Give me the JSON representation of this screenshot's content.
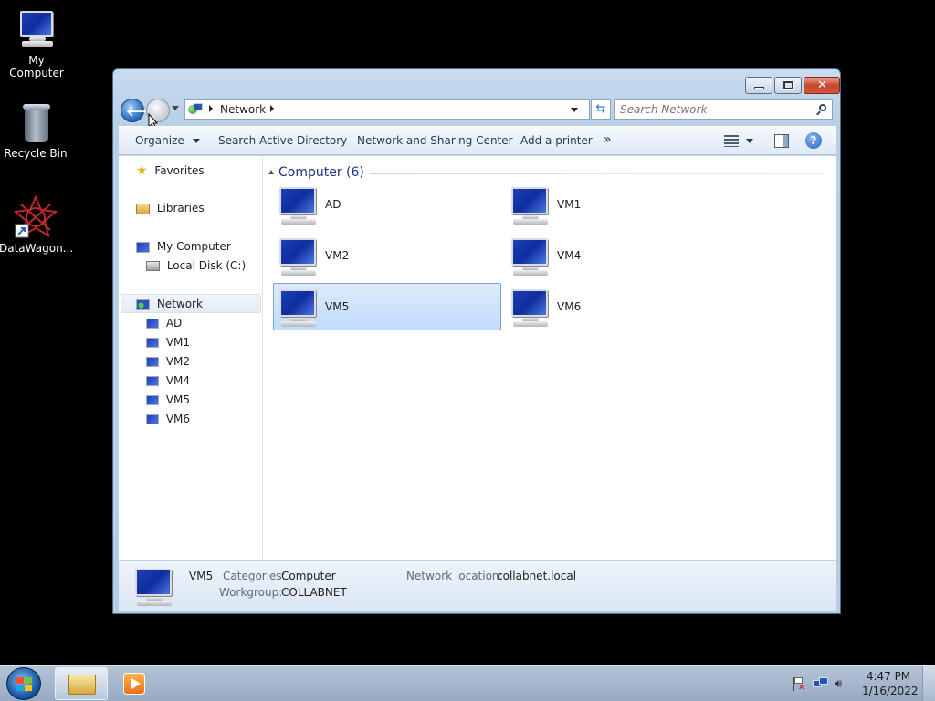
{
  "desktop": {
    "icons": [
      {
        "label": "My Computer"
      },
      {
        "label": "Recycle Bin"
      },
      {
        "label": "DataWagon..."
      }
    ]
  },
  "window": {
    "address": {
      "segment": "Network"
    },
    "search": {
      "placeholder": "Search Network"
    },
    "toolbar": {
      "organize": "Organize",
      "search_ad": "Search Active Directory",
      "network_sharing": "Network and Sharing Center",
      "add_printer": "Add a printer",
      "more": "»"
    },
    "nav_pane": {
      "favorites": "Favorites",
      "libraries": "Libraries",
      "my_computer": "My Computer",
      "local_disk": "Local Disk (C:)",
      "network": "Network",
      "network_children": [
        "AD",
        "VM1",
        "VM2",
        "VM4",
        "VM5",
        "VM6"
      ]
    },
    "group": {
      "header": "Computer (6)"
    },
    "items": [
      {
        "label": "AD"
      },
      {
        "label": "VM1"
      },
      {
        "label": "VM2"
      },
      {
        "label": "VM4"
      },
      {
        "label": "VM5",
        "selected": true
      },
      {
        "label": "VM6"
      }
    ],
    "details": {
      "name": "VM5",
      "categories_label": "Categories:",
      "categories_value": "Computer",
      "workgroup_label": "Workgroup:",
      "workgroup_value": "COLLABNET",
      "network_location_label": "Network location:",
      "network_location_value": "collabnet.local"
    }
  },
  "taskbar": {
    "time": "4:47 PM",
    "date": "1/16/2022"
  },
  "colors": {
    "selection": "#c1dcfc",
    "accent": "#1e395b",
    "group_header": "#1e3287"
  }
}
